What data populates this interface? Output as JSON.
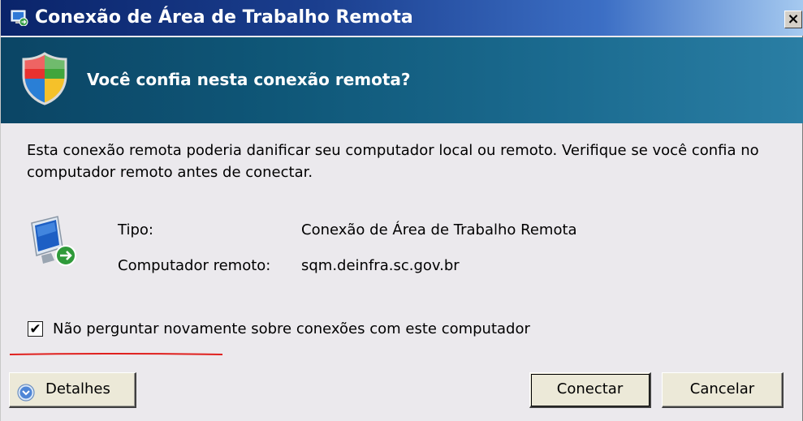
{
  "window": {
    "title": "Conexão de Área de Trabalho Remota",
    "close_label": "×"
  },
  "header": {
    "question": "Você confia nesta conexão remota?"
  },
  "message": "Esta conexão remota poderia danificar seu computador local ou remoto. Verifique se você confia no computador remoto antes de conectar.",
  "info": {
    "type_label": "Tipo:",
    "type_value": "Conexão de Área de Trabalho Remota",
    "computer_label": "Computador remoto:",
    "computer_value": "sqm.deinfra.sc.gov.br"
  },
  "checkbox": {
    "label": "Não perguntar novamente sobre conexões com este computador",
    "checked": true,
    "mark": "✔"
  },
  "buttons": {
    "details": "Detalhes",
    "connect": "Conectar",
    "cancel": "Cancelar"
  },
  "colors": {
    "annotation_underline": "#e0201e",
    "header_band": "#0f5778"
  }
}
